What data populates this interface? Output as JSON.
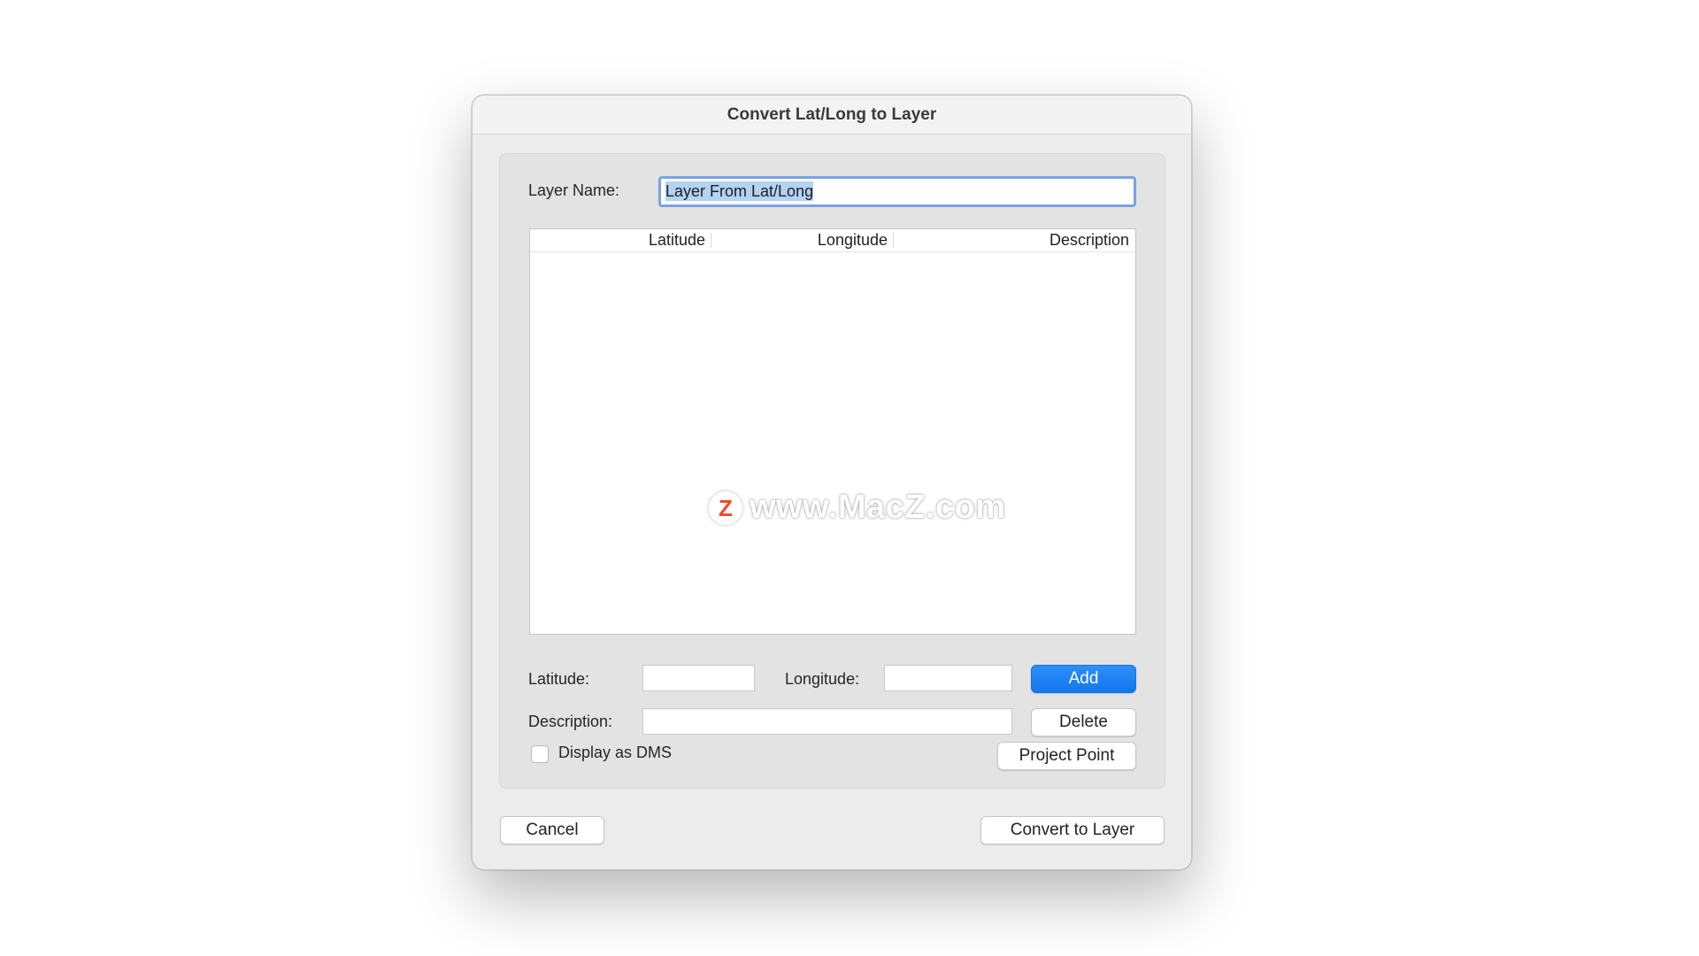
{
  "dialog": {
    "title": "Convert Lat/Long to Layer"
  },
  "layer_name": {
    "label": "Layer Name:",
    "value": "Layer From Lat/Long"
  },
  "table": {
    "columns": [
      "Latitude",
      "Longitude",
      "Description"
    ],
    "rows": []
  },
  "watermark": {
    "logo_letter": "Z",
    "text": "www.MacZ.com"
  },
  "form": {
    "latitude_label": "Latitude:",
    "latitude_value": "",
    "longitude_label": "Longitude:",
    "longitude_value": "",
    "description_label": "Description:",
    "description_value": "",
    "add_label": "Add",
    "delete_label": "Delete",
    "dms_label": "Display as DMS",
    "dms_checked": false,
    "project_point_label": "Project Point"
  },
  "footer": {
    "cancel_label": "Cancel",
    "convert_label": "Convert to Layer"
  },
  "colors": {
    "accent": "#1a7ff2",
    "selection": "#b3d2f4",
    "focus_ring": "#7aa2e6"
  }
}
